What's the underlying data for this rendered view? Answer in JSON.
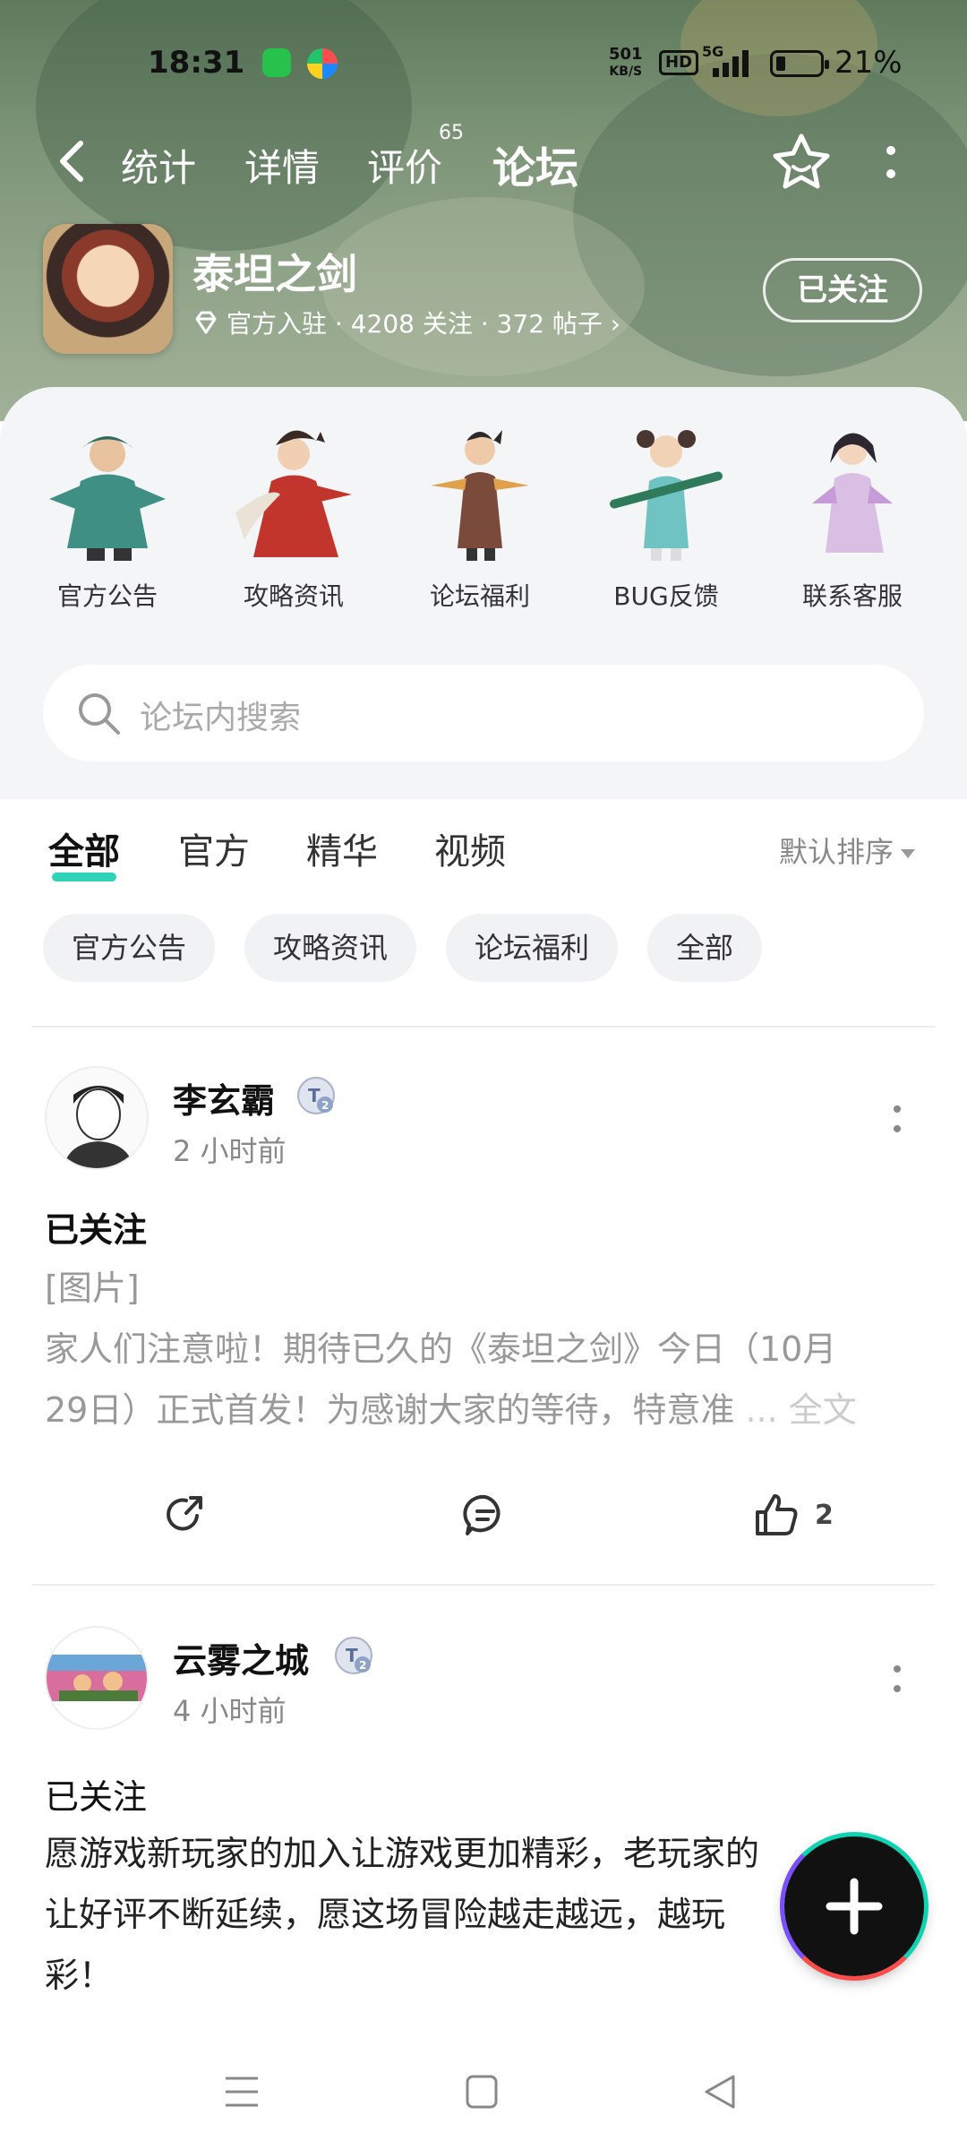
{
  "status_bar": {
    "time": "18:31",
    "net_speed_value": "501",
    "net_speed_unit": "KB/S",
    "hd": "HD",
    "network": "5G",
    "battery": "21%"
  },
  "top_nav": {
    "tabs": [
      {
        "label": "统计"
      },
      {
        "label": "详情"
      },
      {
        "label": "评价",
        "badge": "65"
      },
      {
        "label": "论坛",
        "active": true
      }
    ]
  },
  "forum": {
    "name": "泰坦之剑",
    "meta": "官方入驻 · 4208 关注 · 372 帖子 ›",
    "follow_label": "已关注"
  },
  "categories": [
    {
      "label": "官方公告",
      "icon": "official-announcement-character"
    },
    {
      "label": "攻略资讯",
      "icon": "guide-character"
    },
    {
      "label": "论坛福利",
      "icon": "welfare-character"
    },
    {
      "label": "BUG反馈",
      "icon": "bug-feedback-character"
    },
    {
      "label": "联系客服",
      "icon": "customer-service-character"
    }
  ],
  "search": {
    "placeholder": "论坛内搜索"
  },
  "filter_tabs": [
    {
      "label": "全部",
      "active": true
    },
    {
      "label": "官方"
    },
    {
      "label": "精华"
    },
    {
      "label": "视频"
    }
  ],
  "sort_label": "默认排序",
  "chips": [
    "官方公告",
    "攻略资讯",
    "论坛福利",
    "全部"
  ],
  "posts": [
    {
      "author": "李玄霸",
      "level": "2",
      "time": "2 小时前",
      "title": "已关注",
      "image_tag": "[图片]",
      "text_line1": "家人们注意啦！期待已久的《泰坦之剑》今日（10月",
      "text_line2": "29日）正式首发！为感谢大家的等待，特意准",
      "ellipsis": "...",
      "full_text_label": "全文",
      "like_count": "2"
    },
    {
      "author": "云雾之城",
      "level": "2",
      "time": "4 小时前",
      "title": "已关注",
      "text_line1": "愿游戏新玩家的加入让游戏更加精彩，老玩家的",
      "text_line2": "让好评不断延续，愿这场冒险越走越远，越玩",
      "text_line3": "彩！"
    }
  ],
  "colors": {
    "accent": "#2fd3b7",
    "header_bg": "#7e9578",
    "sheet_bg": "#f4f5f7"
  }
}
